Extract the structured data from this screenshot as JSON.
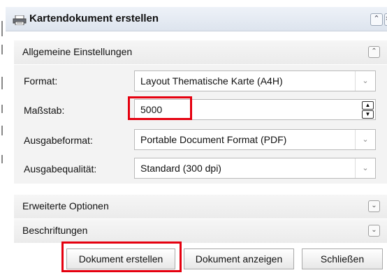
{
  "window": {
    "title": "Kartendokument erstellen",
    "title_icon": "printer-icon",
    "buttons": [
      "collapse-icon",
      "close-icon"
    ]
  },
  "sections": {
    "general": {
      "label": "Allgemeine Einstellungen",
      "icon": "chevron-up-icon"
    },
    "advanced": {
      "label": "Erweiterte Optionen",
      "icon": "chevron-down-icon"
    },
    "labels": {
      "label": "Beschriftungen",
      "icon": "chevron-down-icon"
    }
  },
  "fields": {
    "format": {
      "label": "Format:",
      "value": "Layout Thematische Karte (A4H)"
    },
    "scale": {
      "label": "Maßstab:",
      "value": "5000"
    },
    "output_format": {
      "label": "Ausgabeformat:",
      "value": "Portable Document Format (PDF)"
    },
    "output_quality": {
      "label": "Ausgabequalität:",
      "value": "Standard (300 dpi)"
    }
  },
  "actions": {
    "create": "Dokument erstellen",
    "show": "Dokument anzeigen",
    "close": "Schließen"
  },
  "colors": {
    "highlight": "#e5000f"
  }
}
